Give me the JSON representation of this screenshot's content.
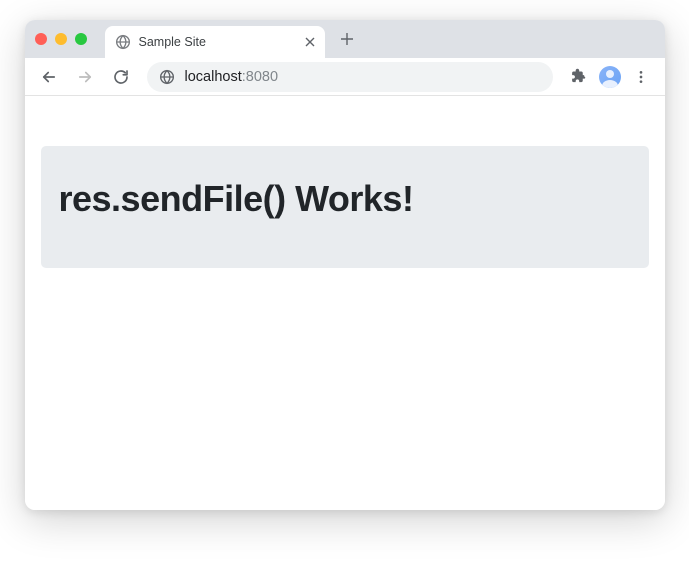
{
  "tab": {
    "title": "Sample Site"
  },
  "address": {
    "host": "localhost",
    "port": ":8080"
  },
  "page": {
    "heading": "res.sendFile() Works!"
  },
  "icons": {
    "close_glyph": "×",
    "newtab_glyph": "+"
  }
}
